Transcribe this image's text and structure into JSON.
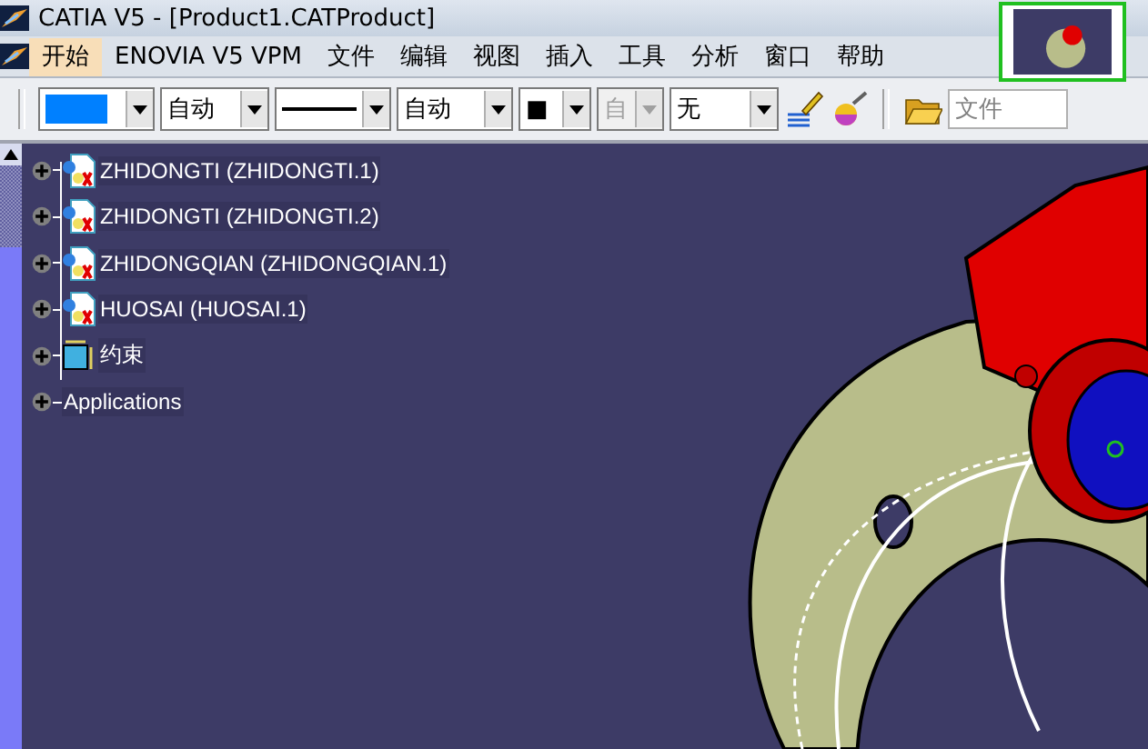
{
  "window": {
    "title": "CATIA V5 - [Product1.CATProduct]"
  },
  "menu": [
    {
      "label": "开始",
      "selected": true
    },
    {
      "label": "ENOVIA V5 VPM",
      "selected": false
    },
    {
      "label": "文件",
      "selected": false
    },
    {
      "label": "编辑",
      "selected": false
    },
    {
      "label": "视图",
      "selected": false
    },
    {
      "label": "插入",
      "selected": false
    },
    {
      "label": "工具",
      "selected": false
    },
    {
      "label": "分析",
      "selected": false
    },
    {
      "label": "窗口",
      "selected": false
    },
    {
      "label": "帮助",
      "selected": false
    }
  ],
  "toolbar": {
    "combos": [
      {
        "kind": "color",
        "color": "#0080ff",
        "disabled": false
      },
      {
        "kind": "text",
        "value": "自动",
        "disabled": false
      },
      {
        "kind": "line",
        "disabled": false
      },
      {
        "kind": "text",
        "value": "自动",
        "disabled": false
      },
      {
        "kind": "text",
        "value": "■",
        "disabled": false
      },
      {
        "kind": "text",
        "value": "自",
        "disabled": true
      },
      {
        "kind": "text",
        "value": "无",
        "disabled": false
      }
    ],
    "file_field": {
      "placeholder": "文件"
    }
  },
  "tree": [
    {
      "kind": "part",
      "label": "ZHIDONGTI (ZHIDONGTI.1)"
    },
    {
      "kind": "part",
      "label": "ZHIDONGTI (ZHIDONGTI.2)"
    },
    {
      "kind": "part",
      "label": "ZHIDONGQIAN (ZHIDONGQIAN.1)"
    },
    {
      "kind": "part",
      "label": "HUOSAI (HUOSAI.1)"
    },
    {
      "kind": "constraints",
      "label": "约束"
    },
    {
      "kind": "plain",
      "label": "Applications"
    }
  ]
}
